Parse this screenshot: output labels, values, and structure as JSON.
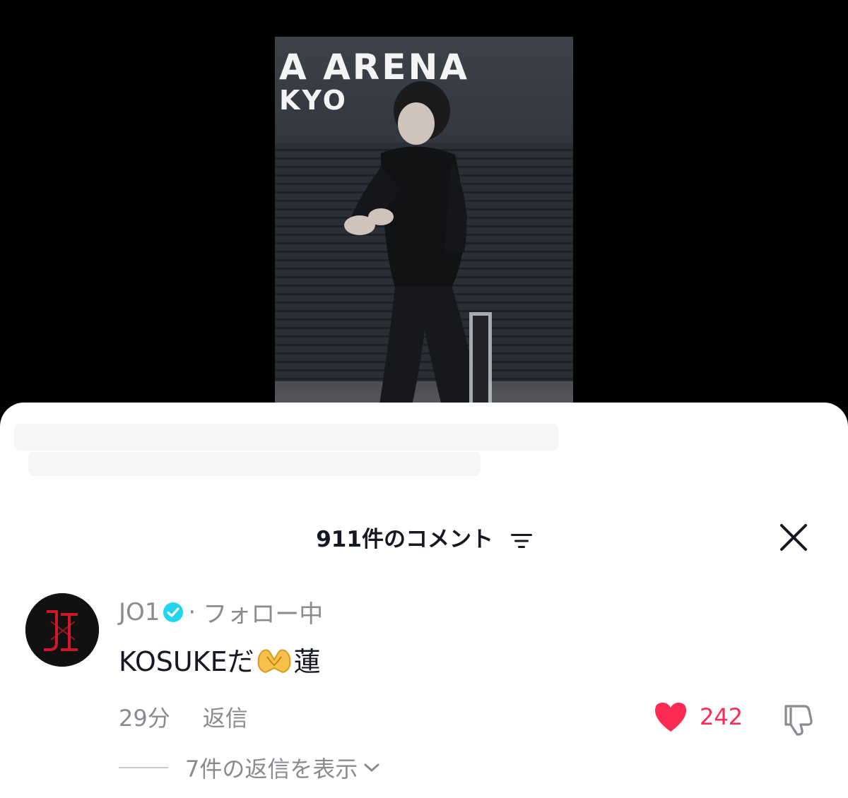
{
  "video": {
    "wall_text_line1": "A ARENA",
    "wall_text_line2": "KYO"
  },
  "comments_panel": {
    "title": "911件のコメント",
    "filter_icon": "filter-lines-icon",
    "close_icon": "close-icon"
  },
  "comment": {
    "username": "JO1",
    "verified_icon": "verified-badge-icon",
    "separator": "·",
    "follow_status": "フォロー中",
    "text_before_emoji": "KOSUKEだ",
    "emoji": "heart-hands-emoji",
    "text_after_emoji": "蓮",
    "time": "29分",
    "reply_label": "返信",
    "like_count": "242",
    "view_replies_label": "7件の返信を表示"
  },
  "colors": {
    "like_red": "#fe2c55",
    "verified_blue": "#20d5ec",
    "text_primary": "#161823",
    "text_secondary": "#8a8b91"
  }
}
